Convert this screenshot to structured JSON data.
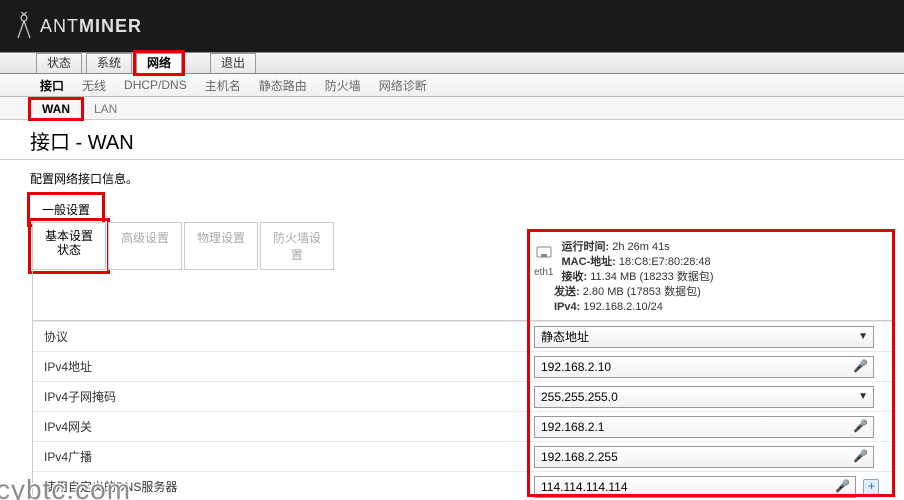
{
  "brand": {
    "name_pre": "ANT",
    "name_bold": "MINER"
  },
  "topnav": {
    "tabs": [
      "状态",
      "系统",
      "网络",
      "退出"
    ],
    "active": 2
  },
  "subnav": {
    "items": [
      "接口",
      "无线",
      "DHCP/DNS",
      "主机名",
      "静态路由",
      "防火墙",
      "网络诊断"
    ],
    "active": 0
  },
  "subnav2": {
    "tabs": [
      "WAN",
      "LAN"
    ],
    "active": 0
  },
  "page": {
    "title": "接口 - WAN",
    "desc": "配置网络接口信息。",
    "legend": "一般设置"
  },
  "settings_tabs": {
    "items": [
      "基本设置 状态",
      "高级设置",
      "物理设置",
      "防火墙设置"
    ],
    "active": 0
  },
  "status": {
    "iface": "eth1",
    "uptime_label": "运行时间:",
    "uptime": "2h 26m 41s",
    "mac_label": "MAC-地址:",
    "mac": "18:C8:E7:80:28:48",
    "rx_label": "接收:",
    "rx": "11.34 MB (18233 数据包)",
    "tx_label": "发送:",
    "tx": "2.80 MB (17853 数据包)",
    "ipv4_label": "IPv4:",
    "ipv4": "192.168.2.10/24"
  },
  "form": {
    "protocol_label": "协议",
    "protocol_value": "静态地址",
    "ipv4_addr_label": "IPv4地址",
    "ipv4_addr_value": "192.168.2.10",
    "ipv4_mask_label": "IPv4子网掩码",
    "ipv4_mask_value": "255.255.255.0",
    "ipv4_gw_label": "IPv4网关",
    "ipv4_gw_value": "192.168.2.1",
    "ipv4_bcast_label": "IPv4广播",
    "ipv4_bcast_value": "192.168.2.255",
    "dns_label": "使用自定义的DNS服务器",
    "dns_value": "114.114.114.114"
  },
  "watermark": "cybtc.com"
}
